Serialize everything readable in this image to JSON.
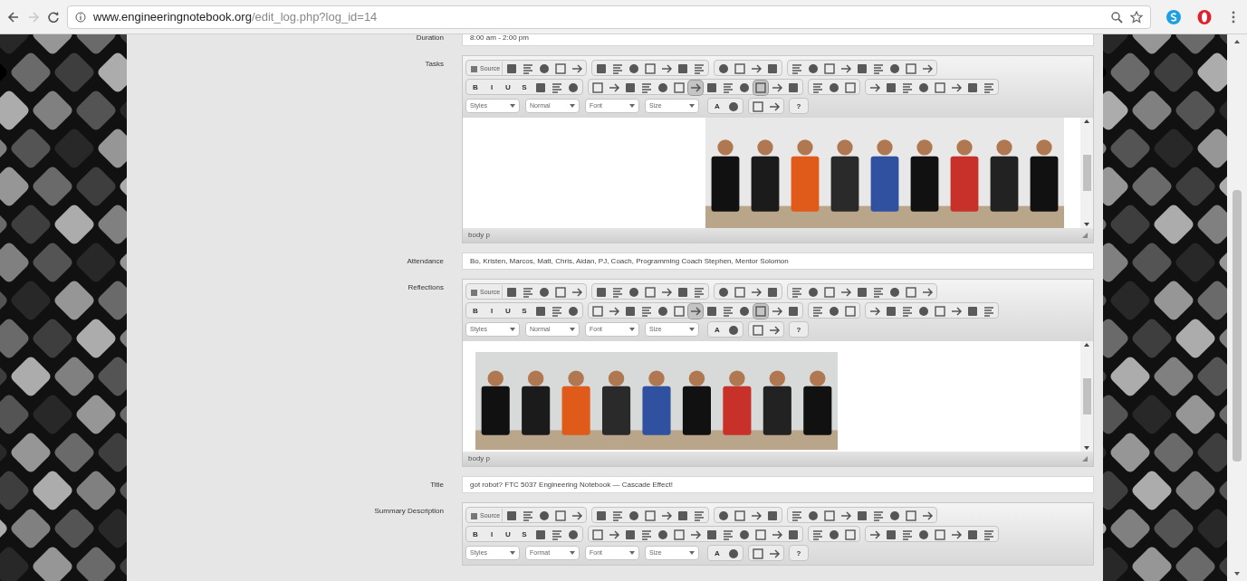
{
  "browser": {
    "url_host": "www.engineeringnotebook.org",
    "url_path": "/edit_log.php?log_id=14",
    "forward_disabled": true
  },
  "form": [
    {
      "kind": "field",
      "label": "Duration",
      "value": "8:00 am - 2:00 pm"
    },
    {
      "kind": "editor",
      "label": "Tasks",
      "content": [
        {
          "kind": "picture"
        }
      ],
      "status": "body p",
      "toolbar": [
        [
          [
            {
              "kind": "source",
              "text": "Source"
            },
            {
              "kind": "icon"
            },
            {
              "kind": "icon"
            },
            {
              "kind": "icon"
            },
            {
              "kind": "icon"
            },
            {
              "kind": "icon"
            }
          ],
          [
            {
              "kind": "icon"
            },
            {
              "kind": "icon"
            },
            {
              "kind": "icon"
            },
            {
              "kind": "icon"
            },
            {
              "kind": "icon"
            },
            {
              "kind": "icon"
            },
            {
              "kind": "icon"
            }
          ],
          [
            {
              "kind": "icon"
            },
            {
              "kind": "icon"
            },
            {
              "kind": "icon"
            },
            {
              "kind": "icon"
            }
          ],
          [
            {
              "kind": "icon"
            },
            {
              "kind": "icon"
            },
            {
              "kind": "icon"
            },
            {
              "kind": "icon"
            },
            {
              "kind": "icon"
            },
            {
              "kind": "icon"
            },
            {
              "kind": "icon"
            },
            {
              "kind": "icon"
            },
            {
              "kind": "icon"
            }
          ]
        ],
        [
          [
            {
              "kind": "glyph",
              "text": "B",
              "on": false
            },
            {
              "kind": "glyph",
              "text": "I",
              "on": false
            },
            {
              "kind": "glyph",
              "text": "U",
              "on": false
            },
            {
              "kind": "glyph",
              "text": "S",
              "on": false
            },
            {
              "kind": "icon",
              "on": false
            },
            {
              "kind": "icon",
              "on": false
            },
            {
              "kind": "icon",
              "on": false
            }
          ],
          [
            {
              "kind": "icon",
              "on": false
            },
            {
              "kind": "icon",
              "on": false
            },
            {
              "kind": "icon",
              "on": false
            },
            {
              "kind": "icon",
              "on": false
            },
            {
              "kind": "icon",
              "on": false
            },
            {
              "kind": "icon",
              "on": false
            },
            {
              "kind": "icon",
              "on": true
            },
            {
              "kind": "icon",
              "on": false
            },
            {
              "kind": "icon",
              "on": false
            },
            {
              "kind": "icon",
              "on": false
            },
            {
              "kind": "icon",
              "on": true
            },
            {
              "kind": "icon",
              "on": false
            },
            {
              "kind": "icon",
              "on": false
            }
          ],
          [
            {
              "kind": "icon",
              "on": false
            },
            {
              "kind": "icon",
              "on": false
            },
            {
              "kind": "icon",
              "on": false
            }
          ],
          [
            {
              "kind": "icon",
              "on": false
            },
            {
              "kind": "icon",
              "on": false
            },
            {
              "kind": "icon",
              "on": false
            },
            {
              "kind": "icon",
              "on": false
            },
            {
              "kind": "icon",
              "on": false
            },
            {
              "kind": "icon",
              "on": false
            },
            {
              "kind": "icon",
              "on": false
            },
            {
              "kind": "icon",
              "on": false
            }
          ]
        ],
        [
          [
            {
              "kind": "combo",
              "text": "Styles"
            },
            {
              "kind": "combo",
              "text": "Normal"
            },
            {
              "kind": "combo",
              "text": "Font"
            },
            {
              "kind": "combo",
              "text": "Size"
            }
          ],
          [
            {
              "kind": "glyph",
              "text": "A",
              "on": false
            },
            {
              "kind": "icon",
              "on": false
            }
          ],
          [
            {
              "kind": "icon",
              "on": false
            },
            {
              "kind": "icon",
              "on": false
            }
          ],
          [
            {
              "kind": "glyph",
              "text": "?",
              "on": false
            }
          ]
        ]
      ]
    },
    {
      "kind": "field",
      "label": "Attendance",
      "value": "Bo, Kristen, Marcos, Matt, Chris, Aidan, PJ, Coach, Programming Coach Stephen, Mentor Solomon"
    },
    {
      "kind": "editor",
      "label": "Reflections",
      "content": [
        {
          "kind": "picture"
        }
      ],
      "status": "body p",
      "toolbar": [
        [
          [
            {
              "kind": "source",
              "text": "Source"
            },
            {
              "kind": "icon"
            },
            {
              "kind": "icon"
            },
            {
              "kind": "icon"
            },
            {
              "kind": "icon"
            },
            {
              "kind": "icon"
            }
          ],
          [
            {
              "kind": "icon"
            },
            {
              "kind": "icon"
            },
            {
              "kind": "icon"
            },
            {
              "kind": "icon"
            },
            {
              "kind": "icon"
            },
            {
              "kind": "icon"
            },
            {
              "kind": "icon"
            }
          ],
          [
            {
              "kind": "icon"
            },
            {
              "kind": "icon"
            },
            {
              "kind": "icon"
            },
            {
              "kind": "icon"
            }
          ],
          [
            {
              "kind": "icon"
            },
            {
              "kind": "icon"
            },
            {
              "kind": "icon"
            },
            {
              "kind": "icon"
            },
            {
              "kind": "icon"
            },
            {
              "kind": "icon"
            },
            {
              "kind": "icon"
            },
            {
              "kind": "icon"
            },
            {
              "kind": "icon"
            }
          ]
        ],
        [
          [
            {
              "kind": "glyph",
              "text": "B",
              "on": false
            },
            {
              "kind": "glyph",
              "text": "I",
              "on": false
            },
            {
              "kind": "glyph",
              "text": "U",
              "on": false
            },
            {
              "kind": "glyph",
              "text": "S",
              "on": false
            },
            {
              "kind": "icon",
              "on": false
            },
            {
              "kind": "icon",
              "on": false
            },
            {
              "kind": "icon",
              "on": false
            }
          ],
          [
            {
              "kind": "icon",
              "on": false
            },
            {
              "kind": "icon",
              "on": false
            },
            {
              "kind": "icon",
              "on": false
            },
            {
              "kind": "icon",
              "on": false
            },
            {
              "kind": "icon",
              "on": false
            },
            {
              "kind": "icon",
              "on": false
            },
            {
              "kind": "icon",
              "on": true
            },
            {
              "kind": "icon",
              "on": false
            },
            {
              "kind": "icon",
              "on": false
            },
            {
              "kind": "icon",
              "on": false
            },
            {
              "kind": "icon",
              "on": true
            },
            {
              "kind": "icon",
              "on": false
            },
            {
              "kind": "icon",
              "on": false
            }
          ],
          [
            {
              "kind": "icon",
              "on": false
            },
            {
              "kind": "icon",
              "on": false
            },
            {
              "kind": "icon",
              "on": false
            }
          ],
          [
            {
              "kind": "icon",
              "on": false
            },
            {
              "kind": "icon",
              "on": false
            },
            {
              "kind": "icon",
              "on": false
            },
            {
              "kind": "icon",
              "on": false
            },
            {
              "kind": "icon",
              "on": false
            },
            {
              "kind": "icon",
              "on": false
            },
            {
              "kind": "icon",
              "on": false
            },
            {
              "kind": "icon",
              "on": false
            }
          ]
        ],
        [
          [
            {
              "kind": "combo",
              "text": "Styles"
            },
            {
              "kind": "combo",
              "text": "Normal"
            },
            {
              "kind": "combo",
              "text": "Font"
            },
            {
              "kind": "combo",
              "text": "Size"
            }
          ],
          [
            {
              "kind": "glyph",
              "text": "A",
              "on": false
            },
            {
              "kind": "icon",
              "on": false
            }
          ],
          [
            {
              "kind": "icon",
              "on": false
            },
            {
              "kind": "icon",
              "on": false
            }
          ],
          [
            {
              "kind": "glyph",
              "text": "?",
              "on": false
            }
          ]
        ]
      ]
    },
    {
      "kind": "field",
      "label": "Title",
      "value": "got robot? FTC 5037 Engineering Notebook — Cascade Effect!"
    },
    {
      "kind": "editor",
      "label": "Summary Description",
      "toolbar": [
        [
          [
            {
              "kind": "source",
              "text": "Source"
            },
            {
              "kind": "icon"
            },
            {
              "kind": "icon"
            },
            {
              "kind": "icon"
            },
            {
              "kind": "icon"
            },
            {
              "kind": "icon"
            }
          ],
          [
            {
              "kind": "icon"
            },
            {
              "kind": "icon"
            },
            {
              "kind": "icon"
            },
            {
              "kind": "icon"
            },
            {
              "kind": "icon"
            },
            {
              "kind": "icon"
            },
            {
              "kind": "icon"
            }
          ],
          [
            {
              "kind": "icon"
            },
            {
              "kind": "icon"
            },
            {
              "kind": "icon"
            },
            {
              "kind": "icon"
            }
          ],
          [
            {
              "kind": "icon"
            },
            {
              "kind": "icon"
            },
            {
              "kind": "icon"
            },
            {
              "kind": "icon"
            },
            {
              "kind": "icon"
            },
            {
              "kind": "icon"
            },
            {
              "kind": "icon"
            },
            {
              "kind": "icon"
            },
            {
              "kind": "icon"
            }
          ]
        ],
        [
          [
            {
              "kind": "glyph",
              "text": "B",
              "on": false
            },
            {
              "kind": "glyph",
              "text": "I",
              "on": false
            },
            {
              "kind": "glyph",
              "text": "U",
              "on": false
            },
            {
              "kind": "glyph",
              "text": "S",
              "on": false
            },
            {
              "kind": "icon",
              "on": false
            },
            {
              "kind": "icon",
              "on": false
            },
            {
              "kind": "icon",
              "on": false
            }
          ],
          [
            {
              "kind": "icon",
              "on": false
            },
            {
              "kind": "icon",
              "on": false
            },
            {
              "kind": "icon",
              "on": false
            },
            {
              "kind": "icon",
              "on": false
            },
            {
              "kind": "icon",
              "on": false
            },
            {
              "kind": "icon",
              "on": false
            },
            {
              "kind": "icon",
              "on": false
            },
            {
              "kind": "icon",
              "on": false
            },
            {
              "kind": "icon",
              "on": false
            },
            {
              "kind": "icon",
              "on": false
            },
            {
              "kind": "icon",
              "on": false
            },
            {
              "kind": "icon",
              "on": false
            },
            {
              "kind": "icon",
              "on": false
            }
          ],
          [
            {
              "kind": "icon",
              "on": false
            },
            {
              "kind": "icon",
              "on": false
            },
            {
              "kind": "icon",
              "on": false
            }
          ],
          [
            {
              "kind": "icon",
              "on": false
            },
            {
              "kind": "icon",
              "on": false
            },
            {
              "kind": "icon",
              "on": false
            },
            {
              "kind": "icon",
              "on": false
            },
            {
              "kind": "icon",
              "on": false
            },
            {
              "kind": "icon",
              "on": false
            },
            {
              "kind": "icon",
              "on": false
            },
            {
              "kind": "icon",
              "on": false
            }
          ]
        ],
        [
          [
            {
              "kind": "combo",
              "text": "Styles"
            },
            {
              "kind": "combo",
              "text": "Format"
            },
            {
              "kind": "combo",
              "text": "Font"
            },
            {
              "kind": "combo",
              "text": "Size"
            }
          ],
          [
            {
              "kind": "glyph",
              "text": "A",
              "on": false
            },
            {
              "kind": "icon",
              "on": false
            }
          ],
          [
            {
              "kind": "icon",
              "on": false
            },
            {
              "kind": "icon",
              "on": false
            }
          ],
          [
            {
              "kind": "glyph",
              "text": "?",
              "on": false
            }
          ]
        ]
      ]
    }
  ]
}
